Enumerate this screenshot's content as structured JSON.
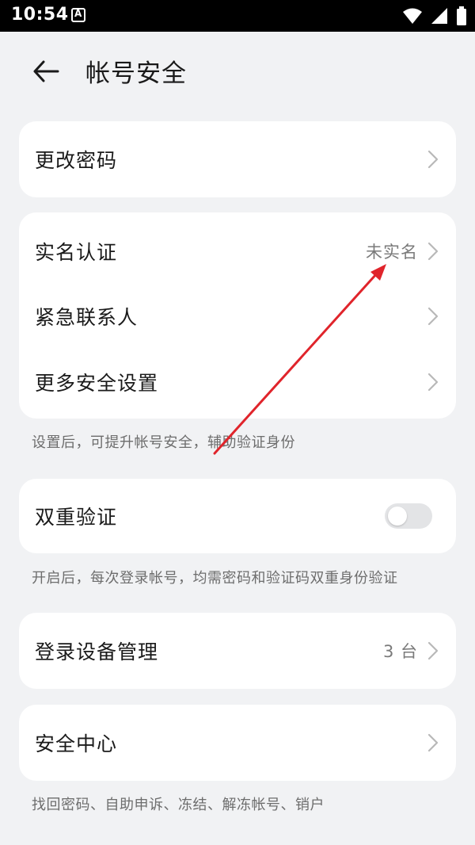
{
  "status_bar": {
    "time": "10:54",
    "icons": [
      "notification-a-icon",
      "wifi-icon",
      "signal-icon",
      "battery-icon"
    ]
  },
  "header": {
    "title": "帐号安全"
  },
  "sections": {
    "password": {
      "label": "更改密码"
    },
    "identity": {
      "items": [
        {
          "label": "实名认证",
          "value": "未实名"
        },
        {
          "label": "紧急联系人",
          "value": ""
        },
        {
          "label": "更多安全设置",
          "value": ""
        }
      ],
      "hint": "设置后，可提升帐号安全，辅助验证身份"
    },
    "two_factor": {
      "label": "双重验证",
      "enabled": false,
      "hint": "开启后，每次登录帐号，均需密码和验证码双重身份验证"
    },
    "devices": {
      "label": "登录设备管理",
      "value": "3 台"
    },
    "security_center": {
      "label": "安全中心",
      "hint": "找回密码、自助申诉、冻结、解冻帐号、销户"
    }
  },
  "colors": {
    "background": "#f1f2f4",
    "card": "#ffffff",
    "annotation_arrow": "#e0242b"
  }
}
